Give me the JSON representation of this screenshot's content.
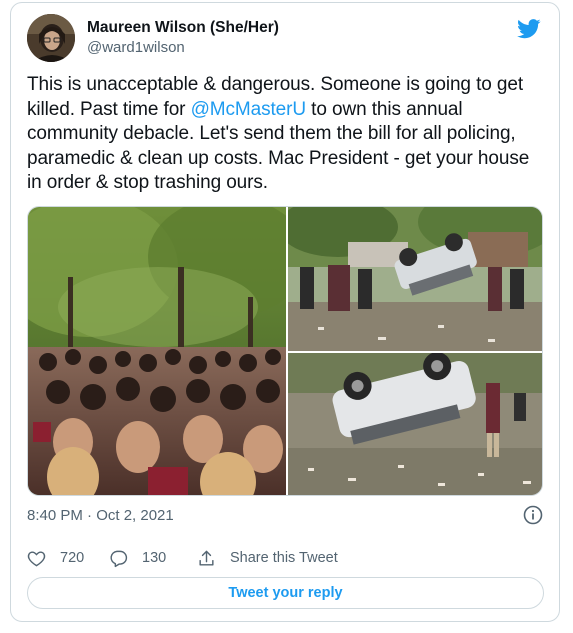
{
  "author": {
    "display_name": "Maureen Wilson (She/Her)",
    "handle": "@ward1wilson"
  },
  "tweet": {
    "text_before": "This is unacceptable & dangerous. Someone is going to get killed. Past time for ",
    "mention": "@McMasterU",
    "text_after": " to own this annual community debacle. Let's send them the bill for all policing, paramedic & clean up costs. Mac President - get your house in order & stop trashing ours.",
    "timestamp": "8:40 PM · Oct 2, 2021"
  },
  "media": {
    "images": [
      "crowd-photo",
      "overturned-car-photo",
      "overturned-car-closeup-photo"
    ]
  },
  "actions": {
    "likes": "720",
    "replies": "130",
    "share_label": "Share this Tweet"
  },
  "reply_button_label": "Tweet your reply",
  "icons": {
    "brand": "twitter-bird-icon",
    "like": "heart-icon",
    "reply": "comment-icon",
    "share": "share-icon",
    "info": "info-icon"
  },
  "colors": {
    "accent": "#1d9bf0",
    "text": "#0f1419",
    "secondary": "#536471",
    "border": "#cfd9de"
  }
}
